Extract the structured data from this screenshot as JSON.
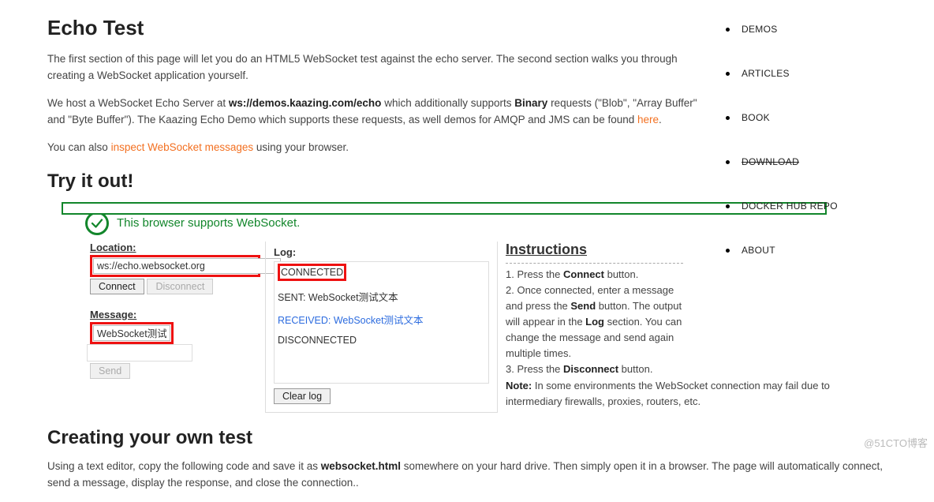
{
  "nav": {
    "items": [
      {
        "label": "DEMOS"
      },
      {
        "label": "ARTICLES"
      },
      {
        "label": "BOOK"
      },
      {
        "label": "DOWNLOAD",
        "struck": true
      },
      {
        "label": "DOCKER HUB REPO"
      },
      {
        "label": "ABOUT"
      }
    ]
  },
  "headings": {
    "title": "Echo Test",
    "try": "Try it out!",
    "creating": "Creating your own test",
    "instructions": "Instructions"
  },
  "intro": {
    "p1": "The first section of this page will let you do an HTML5 WebSocket test against the echo server. The second section walks you through creating a WebSocket application yourself.",
    "p2_a": "We host a WebSocket Echo Server at ",
    "p2_ws": "ws://demos.kaazing.com/echo",
    "p2_b": " which additionally supports ",
    "p2_binary": "Binary",
    "p2_c": " requests (\"Blob\", \"Array Buffer\" and \"Byte Buffer\"). The Kaazing Echo Demo which supports these requests, as well demos for AMQP and JMS can be found ",
    "p2_here": "here",
    "p2_d": ".",
    "p3_a": "You can also ",
    "p3_link": "inspect WebSocket messages",
    "p3_b": " using your browser."
  },
  "support": {
    "text": "This browser supports WebSocket."
  },
  "form": {
    "location_label": "Location:",
    "location_value": "ws://echo.websocket.org",
    "connect": "Connect",
    "disconnect": "Disconnect",
    "message_label": "Message:",
    "message_value": "WebSocket测试文本",
    "send": "Send"
  },
  "log": {
    "title": "Log:",
    "connected": "CONNECTED",
    "sent_prefix": "SENT: ",
    "sent_body": "WebSocket测试文本",
    "recv_prefix": "RECEIVED: ",
    "recv_body": "WebSocket测试文本",
    "disconnected": "DISCONNECTED",
    "clear": "Clear log"
  },
  "instructions": {
    "i1_a": "1. Press the ",
    "i1_b": "Connect",
    "i1_c": " button.",
    "i2_a": "2. Once connected, enter a message and press the ",
    "i2_b": "Send",
    "i2_c": " button. The output will appear in the ",
    "i2_d": "Log",
    "i2_e": " section. You can change the message and send again multiple times.",
    "i3_a": "3. Press the ",
    "i3_b": "Disconnect",
    "i3_c": " button.",
    "note_a": "Note:",
    "note_b": " In some environments the WebSocket connection may fail due to intermediary firewalls, proxies, routers, etc."
  },
  "creating": {
    "p_a": "Using a text editor, copy the following code and save it as ",
    "p_b": "websocket.html",
    "p_c": " somewhere on your hard drive. Then simply open it in a browser. The page will automatically connect, send a message, display the response, and close the connection.."
  },
  "watermark": "@51CTO博客"
}
